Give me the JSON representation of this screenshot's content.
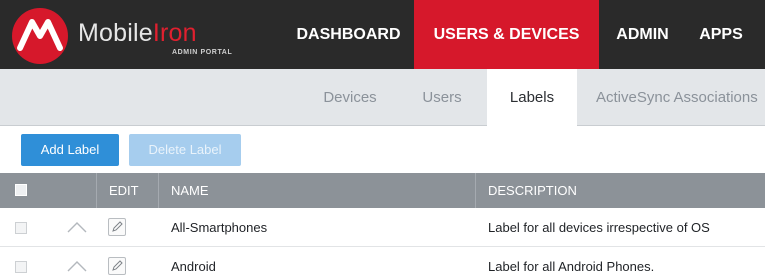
{
  "header": {
    "brand_first": "Mobile",
    "brand_second": "Iron",
    "brand_subtitle": "ADMIN PORTAL",
    "accent_color": "#d6182b",
    "nav": [
      {
        "label": "DASHBOARD",
        "active": false
      },
      {
        "label": "USERS & DEVICES",
        "active": true
      },
      {
        "label": "ADMIN",
        "active": false
      },
      {
        "label": "APPS",
        "active": false
      }
    ]
  },
  "subnav": {
    "tabs": [
      {
        "label": "Devices",
        "active": false
      },
      {
        "label": "Users",
        "active": false
      },
      {
        "label": "Labels",
        "active": true
      },
      {
        "label": "ActiveSync Associations",
        "active": false
      }
    ]
  },
  "toolbar": {
    "add_label": "Add Label",
    "delete_label": "Delete Label"
  },
  "table": {
    "columns": [
      "EDIT",
      "NAME",
      "DESCRIPTION"
    ],
    "rows": [
      {
        "name": "All-Smartphones",
        "description": "Label for all devices irrespective of OS"
      },
      {
        "name": "Android",
        "description": "Label for all Android Phones."
      }
    ]
  },
  "icons": {
    "logo": "mobileiron-logo-icon",
    "row_expand": "chevron-up-icon",
    "row_edit": "pencil-edit-icon",
    "select": "checkbox-icon"
  }
}
